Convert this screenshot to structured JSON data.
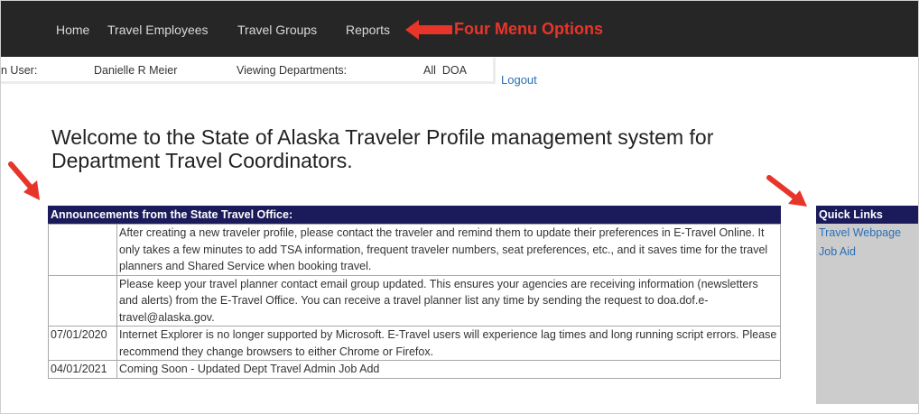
{
  "nav": {
    "items": [
      "Home",
      "Travel Employees",
      "Travel Groups",
      "Reports"
    ],
    "callout": "Four Menu Options"
  },
  "userbar": {
    "user_label": "n User:",
    "user_name": "Danielle R Meier",
    "dept_label": "Viewing Departments:",
    "dept_value": "All  DOA"
  },
  "logout": "Logout",
  "welcome": "Welcome to the State of Alaska Traveler Profile management system for Department Travel Coordinators.",
  "announcements": {
    "title": "Announcements from the State Travel Office:",
    "rows": [
      {
        "date": "",
        "text": "After creating a new traveler profile, please contact the traveler and remind them to update their preferences in E-Travel Online. It only takes a few minutes to add TSA information, frequent traveler numbers, seat preferences, etc., and it saves time for the travel planners and Shared Service when booking travel."
      },
      {
        "date": "",
        "text": "Please keep your travel planner contact email group updated. This ensures your agencies are receiving information (newsletters and alerts) from the E-Travel Office. You can receive a travel planner list any time by sending the request to doa.dof.e-travel@alaska.gov."
      },
      {
        "date": "07/01/2020",
        "text": "Internet Explorer is no longer supported by Microsoft. E-Travel users will experience lag times and long running script errors. Please recommend they change browsers to either Chrome or Firefox."
      },
      {
        "date": "04/01/2021",
        "text": "Coming Soon - Updated Dept Travel Admin Job Add"
      }
    ]
  },
  "quick_links": {
    "title": "Quick Links",
    "items": [
      "Travel Webpage",
      "Job Aid"
    ]
  },
  "colors": {
    "nav_bg": "#262626",
    "header_navy": "#1b1b5c",
    "annotation_red": "#e8352a",
    "link_blue": "#2a6fb6"
  }
}
